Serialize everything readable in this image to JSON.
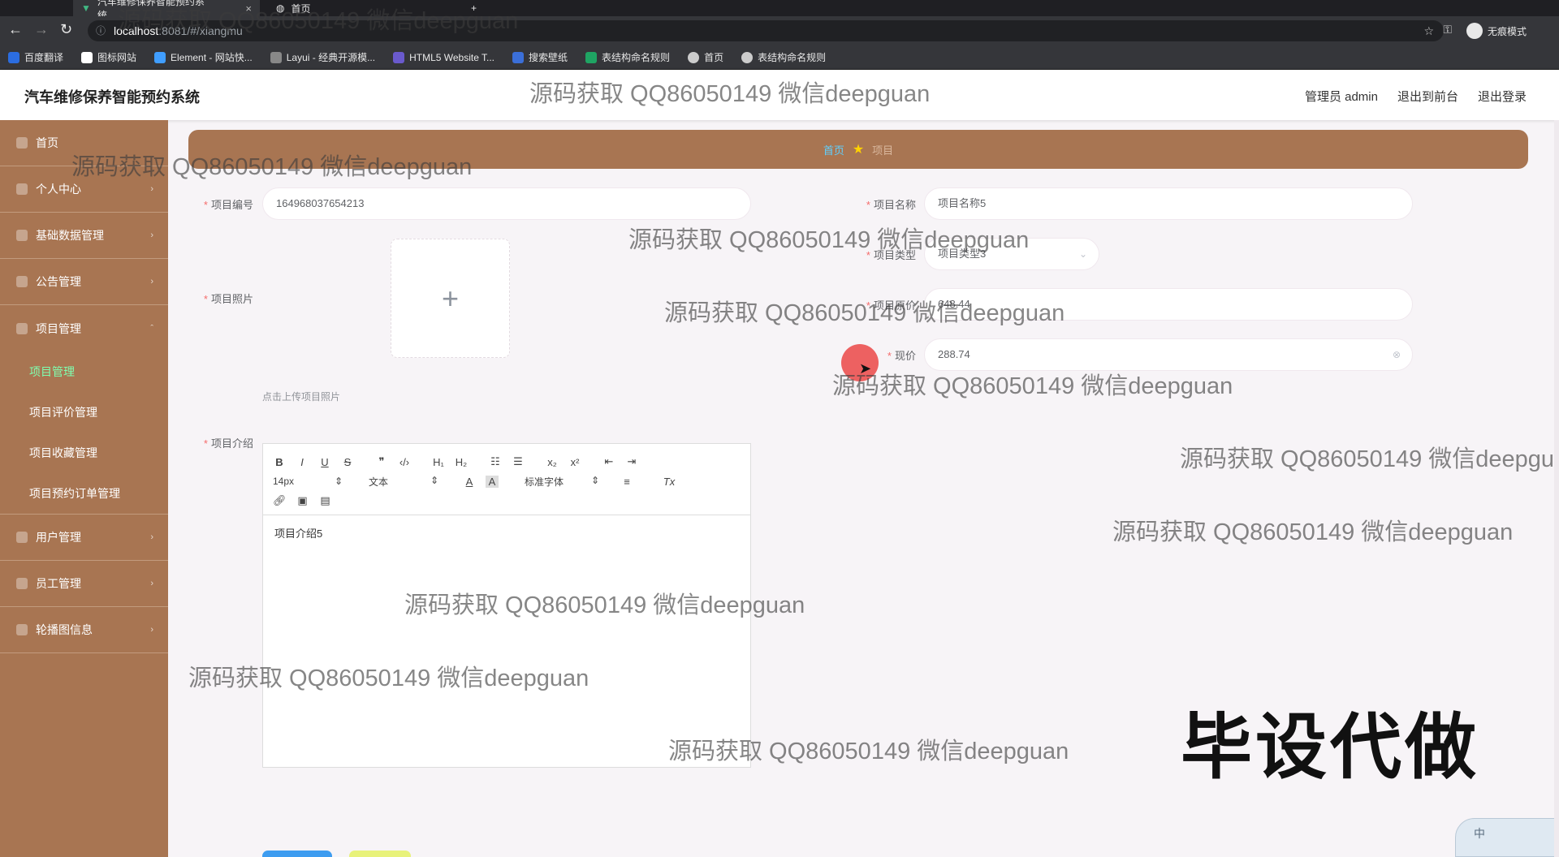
{
  "browser": {
    "tabs": [
      {
        "title": "汽车维修保养智能预约系统",
        "close": "×"
      },
      {
        "title": "首页"
      }
    ],
    "new_tab": "+",
    "url_host": "localhost",
    "url_path": ":8081/#/xiangmu",
    "incognito_label": "无痕模式",
    "bookmarks": [
      "百度翻译",
      "图标网站",
      "Element - 网站快...",
      "Layui - 经典开源模...",
      "HTML5 Website T...",
      "搜索壁纸",
      "表结构命名规则",
      "首页",
      "表结构命名规则"
    ]
  },
  "header": {
    "title": "汽车维修保养智能预约系统",
    "user": "管理员 admin",
    "to_front": "退出到前台",
    "logout": "退出登录"
  },
  "sidebar": {
    "home": "首页",
    "personal": "个人中心",
    "basic_data": "基础数据管理",
    "notice": "公告管理",
    "project": "项目管理",
    "sub": [
      "项目管理",
      "项目评价管理",
      "项目收藏管理",
      "项目预约订单管理"
    ],
    "users": "用户管理",
    "staff": "员工管理",
    "carousel": "轮播图信息"
  },
  "breadcrumb": {
    "home": "首页",
    "current": "项目"
  },
  "form": {
    "code_label": "项目编号",
    "code_value": "164968037654213",
    "name_label": "项目名称",
    "name_value": "项目名称5",
    "type_label": "项目类型",
    "type_value": "项目类型3",
    "orig_price_label": "项目原价",
    "orig_price_value": "648.44",
    "price_label": "现价",
    "price_value": "288.74",
    "photo_label": "项目照片",
    "upload_plus": "+",
    "upload_hint": "点击上传项目照片",
    "intro_label": "项目介绍",
    "intro_value": "项目介绍5"
  },
  "editor": {
    "row1": [
      "B",
      "I",
      "U",
      "S",
      "❞",
      "‹/›",
      "H₁",
      "H₂",
      "☷",
      "☰",
      "x₂",
      "x²",
      "⇤",
      "⇥"
    ],
    "font_size": "14px",
    "text_type": "文本",
    "font_family": "标准字体",
    "color_a": "A",
    "bg_a": "A",
    "align": "≡",
    "clear": "Tx"
  },
  "overlay": {
    "watermark": "源码获取 QQ86050149 微信deepguan",
    "big": "毕设代做",
    "ime": "中"
  },
  "colors": {
    "sidebar": "#a87552",
    "accent_active": "#7fffb0",
    "breadcrumb_home": "#5fd0ff"
  }
}
